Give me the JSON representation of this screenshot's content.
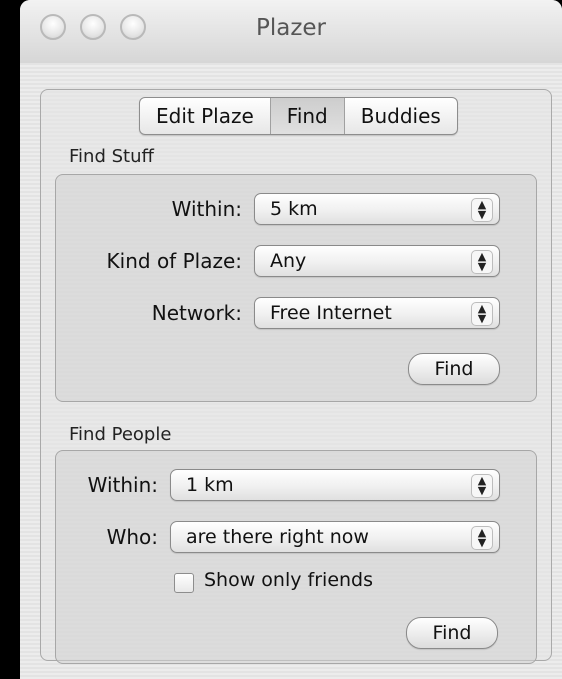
{
  "window": {
    "title": "Plazer"
  },
  "tabs": [
    {
      "label": "Edit Plaze"
    },
    {
      "label": "Find"
    },
    {
      "label": "Buddies"
    }
  ],
  "active_tab": "Find",
  "find_stuff": {
    "section_label": "Find Stuff",
    "within_label": "Within:",
    "within_value": "5 km",
    "kind_label": "Kind of Plaze:",
    "kind_value": "Any",
    "network_label": "Network:",
    "network_value": "Free Internet",
    "find_button": "Find"
  },
  "find_people": {
    "section_label": "Find People",
    "within_label": "Within:",
    "within_value": "1 km",
    "who_label": "Who:",
    "who_value": "are there right now",
    "show_friends_label": "Show only friends",
    "show_friends_checked": false,
    "find_button": "Find"
  }
}
